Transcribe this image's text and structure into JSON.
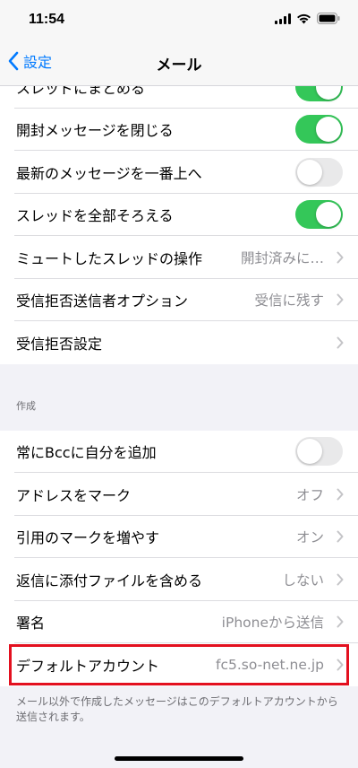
{
  "status_bar": {
    "time": "11:54"
  },
  "nav": {
    "back_label": "設定",
    "title": "メール"
  },
  "threads_group": {
    "rows": [
      {
        "label": "スレッドにまとめる",
        "type": "toggle",
        "on": true
      },
      {
        "label": "開封メッセージを閉じる",
        "type": "toggle",
        "on": true
      },
      {
        "label": "最新のメッセージを一番上へ",
        "type": "toggle",
        "on": false
      },
      {
        "label": "スレッドを全部そろえる",
        "type": "toggle",
        "on": true
      },
      {
        "label": "ミュートしたスレッドの操作",
        "type": "link",
        "value": "開封済みに…"
      },
      {
        "label": "受信拒否送信者オプション",
        "type": "link",
        "value": "受信に残す"
      },
      {
        "label": "受信拒否設定",
        "type": "link",
        "value": ""
      }
    ]
  },
  "compose_section": {
    "header": "作成",
    "rows": [
      {
        "label": "常にBccに自分を追加",
        "type": "toggle",
        "on": false
      },
      {
        "label": "アドレスをマーク",
        "type": "link",
        "value": "オフ"
      },
      {
        "label": "引用のマークを増やす",
        "type": "link",
        "value": "オン"
      },
      {
        "label": "返信に添付ファイルを含める",
        "type": "link",
        "value": "しない"
      },
      {
        "label": "署名",
        "type": "link",
        "value": "iPhoneから送信"
      },
      {
        "label": "デフォルトアカウント",
        "type": "link",
        "value": "fc5.so-net.ne.jp",
        "highlighted": true
      }
    ],
    "footer": "メール以外で作成したメッセージはこのデフォルトアカウントから送信されます。"
  },
  "colors": {
    "accent": "#007aff",
    "toggle_on": "#34c759",
    "highlight": "#e3101f"
  }
}
